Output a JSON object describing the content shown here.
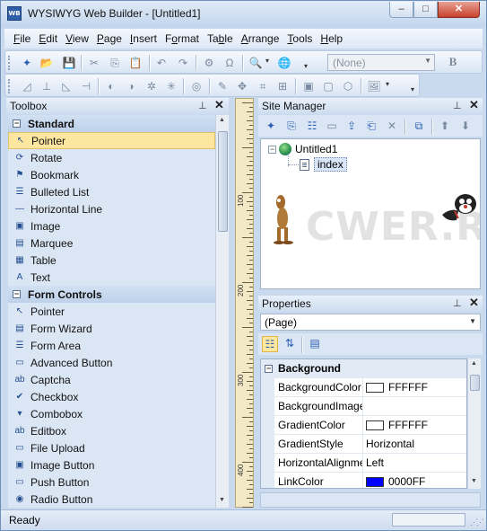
{
  "window": {
    "title": "WYSIWYG Web Builder - [Untitled1]",
    "app_icon": "WB",
    "min": "–",
    "max": "□",
    "close": "✕"
  },
  "menu": [
    "File",
    "Edit",
    "View",
    "Page",
    "Insert",
    "Format",
    "Table",
    "Arrange",
    "Tools",
    "Help"
  ],
  "menu_underline": [
    "F",
    "E",
    "V",
    "P",
    "I",
    "o",
    "b",
    "A",
    "T",
    "H"
  ],
  "toolbar": {
    "font_combo": "(None)",
    "bold_label": "B"
  },
  "toolbox": {
    "title": "Toolbox",
    "pin": "📌",
    "close": "✕",
    "categories": [
      {
        "name": "Standard",
        "items": [
          {
            "label": "Pointer",
            "icon": "pointer-icon",
            "glyph": "↖",
            "selected": true
          },
          {
            "label": "Rotate",
            "icon": "rotate-icon",
            "glyph": "⟳"
          },
          {
            "label": "Bookmark",
            "icon": "bookmark-icon",
            "glyph": "⚑"
          },
          {
            "label": "Bulleted List",
            "icon": "bulleted-list-icon",
            "glyph": "☰"
          },
          {
            "label": "Horizontal Line",
            "icon": "horizontal-line-icon",
            "glyph": "―"
          },
          {
            "label": "Image",
            "icon": "image-icon",
            "glyph": "▣"
          },
          {
            "label": "Marquee",
            "icon": "marquee-icon",
            "glyph": "▤"
          },
          {
            "label": "Table",
            "icon": "table-icon",
            "glyph": "▦"
          },
          {
            "label": "Text",
            "icon": "text-icon",
            "glyph": "A"
          }
        ]
      },
      {
        "name": "Form Controls",
        "items": [
          {
            "label": "Pointer",
            "icon": "pointer-icon",
            "glyph": "↖"
          },
          {
            "label": "Form Wizard",
            "icon": "form-wizard-icon",
            "glyph": "▤"
          },
          {
            "label": "Form Area",
            "icon": "form-area-icon",
            "glyph": "☰"
          },
          {
            "label": "Advanced Button",
            "icon": "advanced-button-icon",
            "glyph": "▭"
          },
          {
            "label": "Captcha",
            "icon": "captcha-icon",
            "glyph": "ab"
          },
          {
            "label": "Checkbox",
            "icon": "checkbox-icon",
            "glyph": "✔"
          },
          {
            "label": "Combobox",
            "icon": "combobox-icon",
            "glyph": "▾"
          },
          {
            "label": "Editbox",
            "icon": "editbox-icon",
            "glyph": "ab"
          },
          {
            "label": "File Upload",
            "icon": "file-upload-icon",
            "glyph": "▭"
          },
          {
            "label": "Image Button",
            "icon": "image-button-icon",
            "glyph": "▣"
          },
          {
            "label": "Push Button",
            "icon": "push-button-icon",
            "glyph": "▭"
          },
          {
            "label": "Radio Button",
            "icon": "radio-button-icon",
            "glyph": "◉"
          }
        ]
      }
    ]
  },
  "ruler": {
    "labels": [
      "100",
      "200",
      "300",
      "400"
    ]
  },
  "site_manager": {
    "title": "Site Manager",
    "tree_root": "Untitled1",
    "tree_child": "index",
    "watermark": "CWER.RU"
  },
  "properties": {
    "title": "Properties",
    "object": "(Page)",
    "category": "Background",
    "rows": [
      {
        "name": "BackgroundColor",
        "value": "FFFFFF",
        "swatch": "#ffffff"
      },
      {
        "name": "BackgroundImage",
        "value": ""
      },
      {
        "name": "GradientColor",
        "value": "FFFFFF",
        "swatch": "#ffffff"
      },
      {
        "name": "GradientStyle",
        "value": "Horizontal"
      },
      {
        "name": "HorizontalAlignment",
        "value": "Left"
      },
      {
        "name": "LinkColor",
        "value": "0000FF",
        "swatch": "#0000ff"
      }
    ]
  },
  "status": {
    "text": "Ready"
  }
}
